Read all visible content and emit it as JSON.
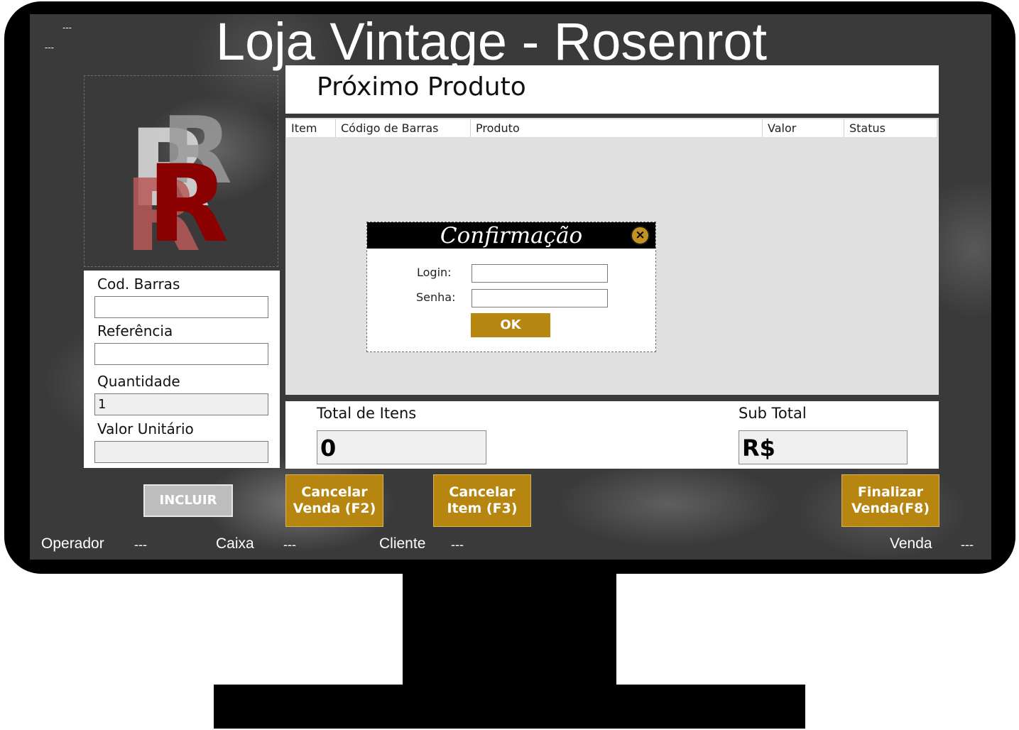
{
  "app": {
    "title": "Loja Vintage - Rosenrot",
    "corner_a": "---",
    "corner_b": "---"
  },
  "logo": {
    "name": "RR-logo-icon"
  },
  "form": {
    "cod_barras_label": "Cod. Barras",
    "cod_barras_value": "",
    "referencia_label": "Referência",
    "referencia_value": "",
    "quantidade_label": "Quantidade",
    "quantidade_value": "1",
    "valor_unitario_label": "Valor Unitário",
    "valor_unitario_value": ""
  },
  "next_product": {
    "label": "Próximo Produto"
  },
  "table": {
    "columns": [
      "Item",
      "Código de Barras",
      "Produto",
      "Valor",
      "Status"
    ],
    "rows": []
  },
  "dialog": {
    "title": "Confirmação",
    "login_label": "Login:",
    "login_value": "",
    "senha_label": "Senha:",
    "senha_value": "",
    "ok_label": "OK",
    "close_symbol": "×"
  },
  "totals": {
    "total_itens_label": "Total de Itens",
    "total_itens_value": "0",
    "sub_total_label": "Sub Total",
    "sub_total_value": "R$"
  },
  "buttons": {
    "incluir": "INCLUIR",
    "cancelar_venda": "Cancelar\nVenda (F2)",
    "cancelar_item": "Cancelar\nItem (F3)",
    "finalizar_venda": "Finalizar\nVenda(F8)"
  },
  "status_bar": {
    "operador_label": "Operador",
    "operador_value": "---",
    "caixa_label": "Caixa",
    "caixa_value": "---",
    "cliente_label": "Cliente",
    "cliente_value": "---",
    "venda_label": "Venda",
    "venda_value": "---"
  },
  "colors": {
    "gold": "#b78610",
    "logo_red": "#8b0000",
    "screen_bg": "#3a3a3a"
  }
}
